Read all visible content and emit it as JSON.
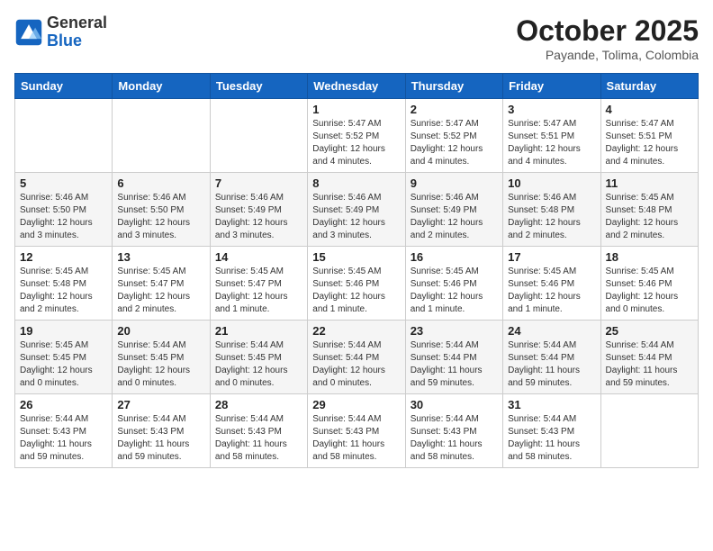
{
  "header": {
    "logo_general": "General",
    "logo_blue": "Blue",
    "month_title": "October 2025",
    "location": "Payande, Tolima, Colombia"
  },
  "days_of_week": [
    "Sunday",
    "Monday",
    "Tuesday",
    "Wednesday",
    "Thursday",
    "Friday",
    "Saturday"
  ],
  "weeks": [
    [
      {
        "day": "",
        "info": ""
      },
      {
        "day": "",
        "info": ""
      },
      {
        "day": "",
        "info": ""
      },
      {
        "day": "1",
        "info": "Sunrise: 5:47 AM\nSunset: 5:52 PM\nDaylight: 12 hours and 4 minutes."
      },
      {
        "day": "2",
        "info": "Sunrise: 5:47 AM\nSunset: 5:52 PM\nDaylight: 12 hours and 4 minutes."
      },
      {
        "day": "3",
        "info": "Sunrise: 5:47 AM\nSunset: 5:51 PM\nDaylight: 12 hours and 4 minutes."
      },
      {
        "day": "4",
        "info": "Sunrise: 5:47 AM\nSunset: 5:51 PM\nDaylight: 12 hours and 4 minutes."
      }
    ],
    [
      {
        "day": "5",
        "info": "Sunrise: 5:46 AM\nSunset: 5:50 PM\nDaylight: 12 hours and 3 minutes."
      },
      {
        "day": "6",
        "info": "Sunrise: 5:46 AM\nSunset: 5:50 PM\nDaylight: 12 hours and 3 minutes."
      },
      {
        "day": "7",
        "info": "Sunrise: 5:46 AM\nSunset: 5:49 PM\nDaylight: 12 hours and 3 minutes."
      },
      {
        "day": "8",
        "info": "Sunrise: 5:46 AM\nSunset: 5:49 PM\nDaylight: 12 hours and 3 minutes."
      },
      {
        "day": "9",
        "info": "Sunrise: 5:46 AM\nSunset: 5:49 PM\nDaylight: 12 hours and 2 minutes."
      },
      {
        "day": "10",
        "info": "Sunrise: 5:46 AM\nSunset: 5:48 PM\nDaylight: 12 hours and 2 minutes."
      },
      {
        "day": "11",
        "info": "Sunrise: 5:45 AM\nSunset: 5:48 PM\nDaylight: 12 hours and 2 minutes."
      }
    ],
    [
      {
        "day": "12",
        "info": "Sunrise: 5:45 AM\nSunset: 5:48 PM\nDaylight: 12 hours and 2 minutes."
      },
      {
        "day": "13",
        "info": "Sunrise: 5:45 AM\nSunset: 5:47 PM\nDaylight: 12 hours and 2 minutes."
      },
      {
        "day": "14",
        "info": "Sunrise: 5:45 AM\nSunset: 5:47 PM\nDaylight: 12 hours and 1 minute."
      },
      {
        "day": "15",
        "info": "Sunrise: 5:45 AM\nSunset: 5:46 PM\nDaylight: 12 hours and 1 minute."
      },
      {
        "day": "16",
        "info": "Sunrise: 5:45 AM\nSunset: 5:46 PM\nDaylight: 12 hours and 1 minute."
      },
      {
        "day": "17",
        "info": "Sunrise: 5:45 AM\nSunset: 5:46 PM\nDaylight: 12 hours and 1 minute."
      },
      {
        "day": "18",
        "info": "Sunrise: 5:45 AM\nSunset: 5:46 PM\nDaylight: 12 hours and 0 minutes."
      }
    ],
    [
      {
        "day": "19",
        "info": "Sunrise: 5:45 AM\nSunset: 5:45 PM\nDaylight: 12 hours and 0 minutes."
      },
      {
        "day": "20",
        "info": "Sunrise: 5:44 AM\nSunset: 5:45 PM\nDaylight: 12 hours and 0 minutes."
      },
      {
        "day": "21",
        "info": "Sunrise: 5:44 AM\nSunset: 5:45 PM\nDaylight: 12 hours and 0 minutes."
      },
      {
        "day": "22",
        "info": "Sunrise: 5:44 AM\nSunset: 5:44 PM\nDaylight: 12 hours and 0 minutes."
      },
      {
        "day": "23",
        "info": "Sunrise: 5:44 AM\nSunset: 5:44 PM\nDaylight: 11 hours and 59 minutes."
      },
      {
        "day": "24",
        "info": "Sunrise: 5:44 AM\nSunset: 5:44 PM\nDaylight: 11 hours and 59 minutes."
      },
      {
        "day": "25",
        "info": "Sunrise: 5:44 AM\nSunset: 5:44 PM\nDaylight: 11 hours and 59 minutes."
      }
    ],
    [
      {
        "day": "26",
        "info": "Sunrise: 5:44 AM\nSunset: 5:43 PM\nDaylight: 11 hours and 59 minutes."
      },
      {
        "day": "27",
        "info": "Sunrise: 5:44 AM\nSunset: 5:43 PM\nDaylight: 11 hours and 59 minutes."
      },
      {
        "day": "28",
        "info": "Sunrise: 5:44 AM\nSunset: 5:43 PM\nDaylight: 11 hours and 58 minutes."
      },
      {
        "day": "29",
        "info": "Sunrise: 5:44 AM\nSunset: 5:43 PM\nDaylight: 11 hours and 58 minutes."
      },
      {
        "day": "30",
        "info": "Sunrise: 5:44 AM\nSunset: 5:43 PM\nDaylight: 11 hours and 58 minutes."
      },
      {
        "day": "31",
        "info": "Sunrise: 5:44 AM\nSunset: 5:43 PM\nDaylight: 11 hours and 58 minutes."
      },
      {
        "day": "",
        "info": ""
      }
    ]
  ]
}
